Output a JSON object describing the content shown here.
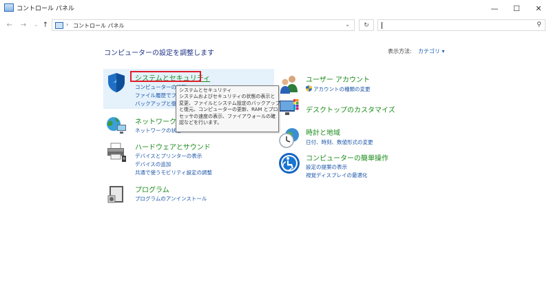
{
  "window": {
    "title": "コントロール パネル",
    "minimize": "—",
    "maximize": "☐",
    "close": "✕"
  },
  "nav": {
    "back": "←",
    "forward": "→",
    "recent": "⌄",
    "up": "↑",
    "address": "コントロール パネル",
    "separator": "›",
    "dropdown": "⌄",
    "refresh": "↻",
    "search_icon": "⚲"
  },
  "header": {
    "title": "コンピューターの設定を調整します",
    "view_by_label": "表示方法:",
    "view_by_value": "カテゴリ ▾"
  },
  "categories": {
    "system": {
      "title": "システムとセキュリティ",
      "links": [
        "コンピューターの状態",
        "ファイル履歴でファ",
        "バックアップと復元"
      ]
    },
    "network": {
      "title": "ネットワークとイ",
      "links": [
        "ネットワークの状態"
      ]
    },
    "hardware": {
      "title": "ハードウェアとサウンド",
      "links": [
        "デバイスとプリンターの表示",
        "デバイスの追加",
        "共通で使うモビリティ設定の調整"
      ]
    },
    "programs": {
      "title": "プログラム",
      "links": [
        "プログラムのアンインストール"
      ]
    },
    "user": {
      "title": "ユーザー アカウント",
      "links": [
        "アカウントの種類の変更"
      ]
    },
    "desktop": {
      "title": "デスクトップのカスタマイズ",
      "links": []
    },
    "clock": {
      "title": "時計と地域",
      "links": [
        "日付、時刻、数値形式の変更"
      ]
    },
    "ease": {
      "title": "コンピューターの簡単操作",
      "links": [
        "設定の提案の表示",
        "視覚ディスプレイの最適化"
      ]
    }
  },
  "tooltip": {
    "lines": [
      "システムとセキュリティ",
      "システムおよびセキュリティの状態の表示と",
      "変更、ファイルとシステム設定のバックアップ",
      "と復元、コンピューターの更新、RAM とプロ",
      "セッサの速度の表示、ファイアウォールの確",
      "認などを行います。"
    ]
  },
  "colors": {
    "category_title": "#1a8a1a",
    "link": "#1a55a8",
    "header": "#1e3287",
    "highlight": "#e11d2a",
    "hover_bg": "#e5f1fb"
  }
}
